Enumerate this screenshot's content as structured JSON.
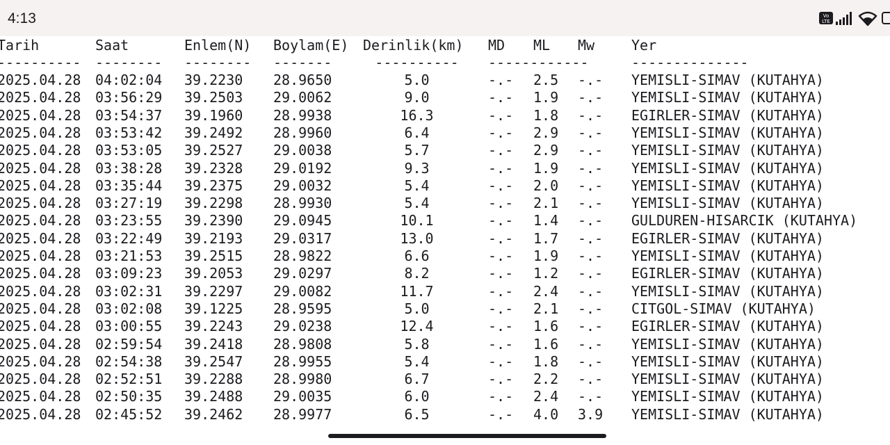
{
  "status_bar": {
    "time": "4:13",
    "volte_label": "Vo LTE",
    "icons": [
      "volte-icon",
      "signal-icon",
      "wifi-icon",
      "battery-icon"
    ]
  },
  "table": {
    "headers": {
      "date": "Tarih",
      "time": "Saat",
      "lat": "Enlem(N)",
      "lon": "Boylam(E)",
      "depth": "Derinlik(km)",
      "md": "MD",
      "ml": "ML",
      "mw": "Mw",
      "loc": "Yer"
    },
    "separators": {
      "date": "----------",
      "time": "--------",
      "lat": "--------",
      "lon": "-------",
      "depth": "----------",
      "mdmlmw": "------------",
      "loc": "--------------"
    },
    "rows": [
      {
        "date": "2025.04.28",
        "time": "04:02:04",
        "lat": "39.2230",
        "lon": "28.9650",
        "depth": "5.0",
        "md": "-.-",
        "ml": "2.5",
        "mw": "-.-",
        "loc": "YEMISLI-SIMAV (KUTAHYA)"
      },
      {
        "date": "2025.04.28",
        "time": "03:56:29",
        "lat": "39.2503",
        "lon": "29.0062",
        "depth": "9.0",
        "md": "-.-",
        "ml": "1.9",
        "mw": "-.-",
        "loc": "YEMISLI-SIMAV (KUTAHYA)"
      },
      {
        "date": "2025.04.28",
        "time": "03:54:37",
        "lat": "39.1960",
        "lon": "28.9938",
        "depth": "16.3",
        "md": "-.-",
        "ml": "1.8",
        "mw": "-.-",
        "loc": "EGIRLER-SIMAV (KUTAHYA)"
      },
      {
        "date": "2025.04.28",
        "time": "03:53:42",
        "lat": "39.2492",
        "lon": "28.9960",
        "depth": "6.4",
        "md": "-.-",
        "ml": "2.9",
        "mw": "-.-",
        "loc": "YEMISLI-SIMAV (KUTAHYA)"
      },
      {
        "date": "2025.04.28",
        "time": "03:53:05",
        "lat": "39.2527",
        "lon": "29.0038",
        "depth": "5.7",
        "md": "-.-",
        "ml": "2.9",
        "mw": "-.-",
        "loc": "YEMISLI-SIMAV (KUTAHYA)"
      },
      {
        "date": "2025.04.28",
        "time": "03:38:28",
        "lat": "39.2328",
        "lon": "29.0192",
        "depth": "9.3",
        "md": "-.-",
        "ml": "1.9",
        "mw": "-.-",
        "loc": "YEMISLI-SIMAV (KUTAHYA)"
      },
      {
        "date": "2025.04.28",
        "time": "03:35:44",
        "lat": "39.2375",
        "lon": "29.0032",
        "depth": "5.4",
        "md": "-.-",
        "ml": "2.0",
        "mw": "-.-",
        "loc": "YEMISLI-SIMAV (KUTAHYA)"
      },
      {
        "date": "2025.04.28",
        "time": "03:27:19",
        "lat": "39.2298",
        "lon": "28.9930",
        "depth": "5.4",
        "md": "-.-",
        "ml": "2.1",
        "mw": "-.-",
        "loc": "YEMISLI-SIMAV (KUTAHYA)"
      },
      {
        "date": "2025.04.28",
        "time": "03:23:55",
        "lat": "39.2390",
        "lon": "29.0945",
        "depth": "10.1",
        "md": "-.-",
        "ml": "1.4",
        "mw": "-.-",
        "loc": "GULDUREN-HISARCIK (KUTAHYA)"
      },
      {
        "date": "2025.04.28",
        "time": "03:22:49",
        "lat": "39.2193",
        "lon": "29.0317",
        "depth": "13.0",
        "md": "-.-",
        "ml": "1.7",
        "mw": "-.-",
        "loc": "EGIRLER-SIMAV (KUTAHYA)"
      },
      {
        "date": "2025.04.28",
        "time": "03:21:53",
        "lat": "39.2515",
        "lon": "28.9822",
        "depth": "6.6",
        "md": "-.-",
        "ml": "1.9",
        "mw": "-.-",
        "loc": "YEMISLI-SIMAV (KUTAHYA)"
      },
      {
        "date": "2025.04.28",
        "time": "03:09:23",
        "lat": "39.2053",
        "lon": "29.0297",
        "depth": "8.2",
        "md": "-.-",
        "ml": "1.2",
        "mw": "-.-",
        "loc": "EGIRLER-SIMAV (KUTAHYA)"
      },
      {
        "date": "2025.04.28",
        "time": "03:02:31",
        "lat": "39.2297",
        "lon": "29.0082",
        "depth": "11.7",
        "md": "-.-",
        "ml": "2.4",
        "mw": "-.-",
        "loc": "YEMISLI-SIMAV (KUTAHYA)"
      },
      {
        "date": "2025.04.28",
        "time": "03:02:08",
        "lat": "39.1225",
        "lon": "28.9595",
        "depth": "5.0",
        "md": "-.-",
        "ml": "2.1",
        "mw": "-.-",
        "loc": "CITGOL-SIMAV (KUTAHYA)"
      },
      {
        "date": "2025.04.28",
        "time": "03:00:55",
        "lat": "39.2243",
        "lon": "29.0238",
        "depth": "12.4",
        "md": "-.-",
        "ml": "1.6",
        "mw": "-.-",
        "loc": "EGIRLER-SIMAV (KUTAHYA)"
      },
      {
        "date": "2025.04.28",
        "time": "02:59:54",
        "lat": "39.2418",
        "lon": "28.9808",
        "depth": "5.8",
        "md": "-.-",
        "ml": "1.6",
        "mw": "-.-",
        "loc": "YEMISLI-SIMAV (KUTAHYA)"
      },
      {
        "date": "2025.04.28",
        "time": "02:54:38",
        "lat": "39.2547",
        "lon": "28.9955",
        "depth": "5.4",
        "md": "-.-",
        "ml": "1.8",
        "mw": "-.-",
        "loc": "YEMISLI-SIMAV (KUTAHYA)"
      },
      {
        "date": "2025.04.28",
        "time": "02:52:51",
        "lat": "39.2288",
        "lon": "28.9980",
        "depth": "6.7",
        "md": "-.-",
        "ml": "2.2",
        "mw": "-.-",
        "loc": "YEMISLI-SIMAV (KUTAHYA)"
      },
      {
        "date": "2025.04.28",
        "time": "02:50:35",
        "lat": "39.2488",
        "lon": "29.0035",
        "depth": "6.0",
        "md": "-.-",
        "ml": "2.4",
        "mw": "-.-",
        "loc": "YEMISLI-SIMAV (KUTAHYA)"
      },
      {
        "date": "2025.04.28",
        "time": "02:45:52",
        "lat": "39.2462",
        "lon": "28.9977",
        "depth": "6.5",
        "md": "-.-",
        "ml": "4.0",
        "mw": "3.9",
        "loc": "YEMISLI-SIMAV (KUTAHYA)"
      }
    ]
  }
}
